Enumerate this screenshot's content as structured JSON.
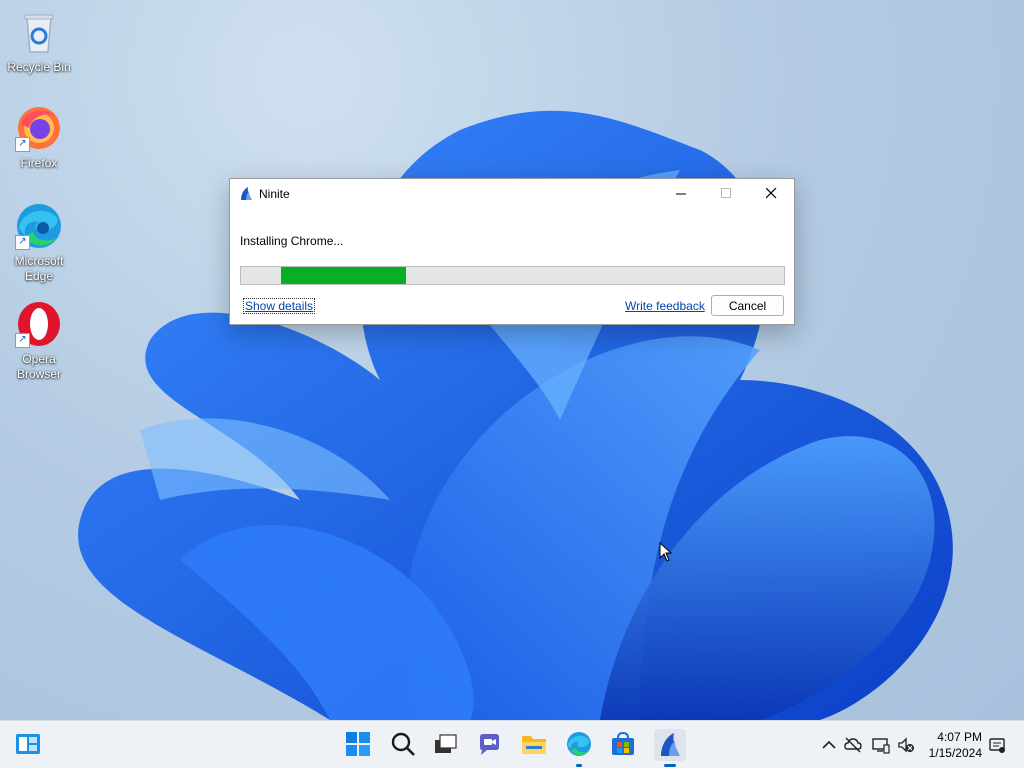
{
  "desktop": {
    "icons": [
      {
        "label": "Recycle Bin",
        "icon": "recycle-bin-icon"
      },
      {
        "label": "Firefox",
        "icon": "firefox-icon"
      },
      {
        "label": "Microsoft Edge",
        "icon": "edge-icon"
      },
      {
        "label": "Opera Browser",
        "icon": "opera-icon"
      }
    ]
  },
  "dialog": {
    "title": "Ninite",
    "status": "Installing Chrome...",
    "progress_fraction": 0.23,
    "progress_color": "#06b025",
    "show_details_label": "Show details",
    "feedback_label": "Write feedback",
    "cancel_label": "Cancel"
  },
  "taskbar": {
    "pinned": [
      "widgets-icon",
      "start-icon",
      "search-icon",
      "task-view-icon",
      "chat-icon",
      "file-explorer-icon",
      "edge-icon",
      "store-icon",
      "ninite-icon"
    ],
    "tray": [
      "chevron-up-icon",
      "onedrive-offline-icon",
      "network-icon",
      "volume-muted-icon",
      "notification-icon"
    ],
    "time": "4:07 PM",
    "date": "1/15/2024"
  },
  "colors": {
    "accent": "#0067c0",
    "link": "#0645ad",
    "progress_green": "#06b025"
  }
}
